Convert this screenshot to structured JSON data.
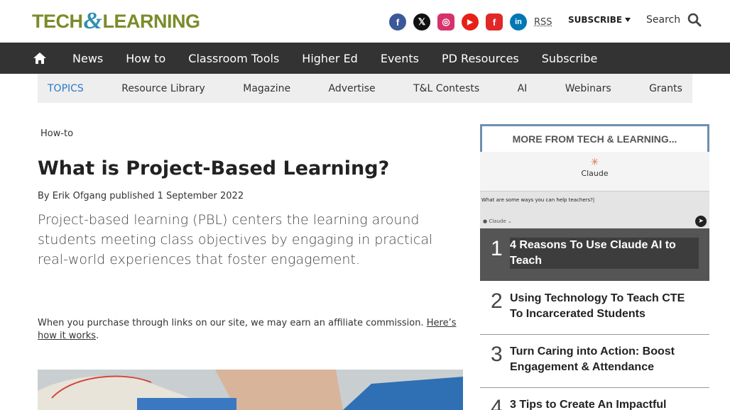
{
  "header": {
    "logo_left": "TECH",
    "logo_amp": "&",
    "logo_right": "LEARNING",
    "social": [
      {
        "name": "facebook-icon",
        "glyph": "f",
        "color": "#3b5998"
      },
      {
        "name": "x-icon",
        "glyph": "𝕏",
        "color": "#111111"
      },
      {
        "name": "instagram-icon",
        "glyph": "◎",
        "color": "#d6336c"
      },
      {
        "name": "youtube-icon",
        "glyph": "▶",
        "color": "#e62117"
      },
      {
        "name": "flipboard-icon",
        "glyph": "f",
        "color": "#e12828"
      },
      {
        "name": "linkedin-icon",
        "glyph": "in",
        "color": "#0077b5"
      }
    ],
    "rss": "RSS",
    "subscribe": "SUBSCRIBE",
    "search": "Search"
  },
  "nav": {
    "items": [
      "News",
      "How to",
      "Classroom Tools",
      "Higher Ed",
      "Events",
      "PD Resources",
      "Subscribe"
    ]
  },
  "topics": {
    "label": "TOPICS",
    "items": [
      "Resource Library",
      "Magazine",
      "Advertise",
      "T&L Contests",
      "AI",
      "Webinars",
      "Grants"
    ]
  },
  "article": {
    "breadcrumb": "How-to",
    "title": "What is Project-Based Learning?",
    "byline_prefix": "By ",
    "author": "Erik Ofgang",
    "published_label": " published ",
    "date": "1 September 2022",
    "standfirst": "Project-based learning (PBL) centers the learning around students meeting class objectives by engaging in practical real-world experiences that foster engagement.",
    "affiliate_text": "When you purchase through links on our site, we may earn an affiliate commission. ",
    "affiliate_link": "Here’s how it works",
    "affiliate_end": "."
  },
  "sidebar": {
    "heading": "MORE FROM TECH & LEARNING...",
    "claude_brand": "Claude",
    "chat_question": "What are some ways you can help teachers?|",
    "chat_model": "● Claude ⌄",
    "items": [
      {
        "rank": "1",
        "title": "4 Reasons To Use Claude AI to Teach"
      },
      {
        "rank": "2",
        "title": "Using Technology To Teach CTE To Incarcerated Students"
      },
      {
        "rank": "3",
        "title": "Turn Caring into Action: Boost Engagement & Attendance"
      },
      {
        "rank": "4",
        "title": "3 Tips to Create An Impactful"
      }
    ]
  }
}
